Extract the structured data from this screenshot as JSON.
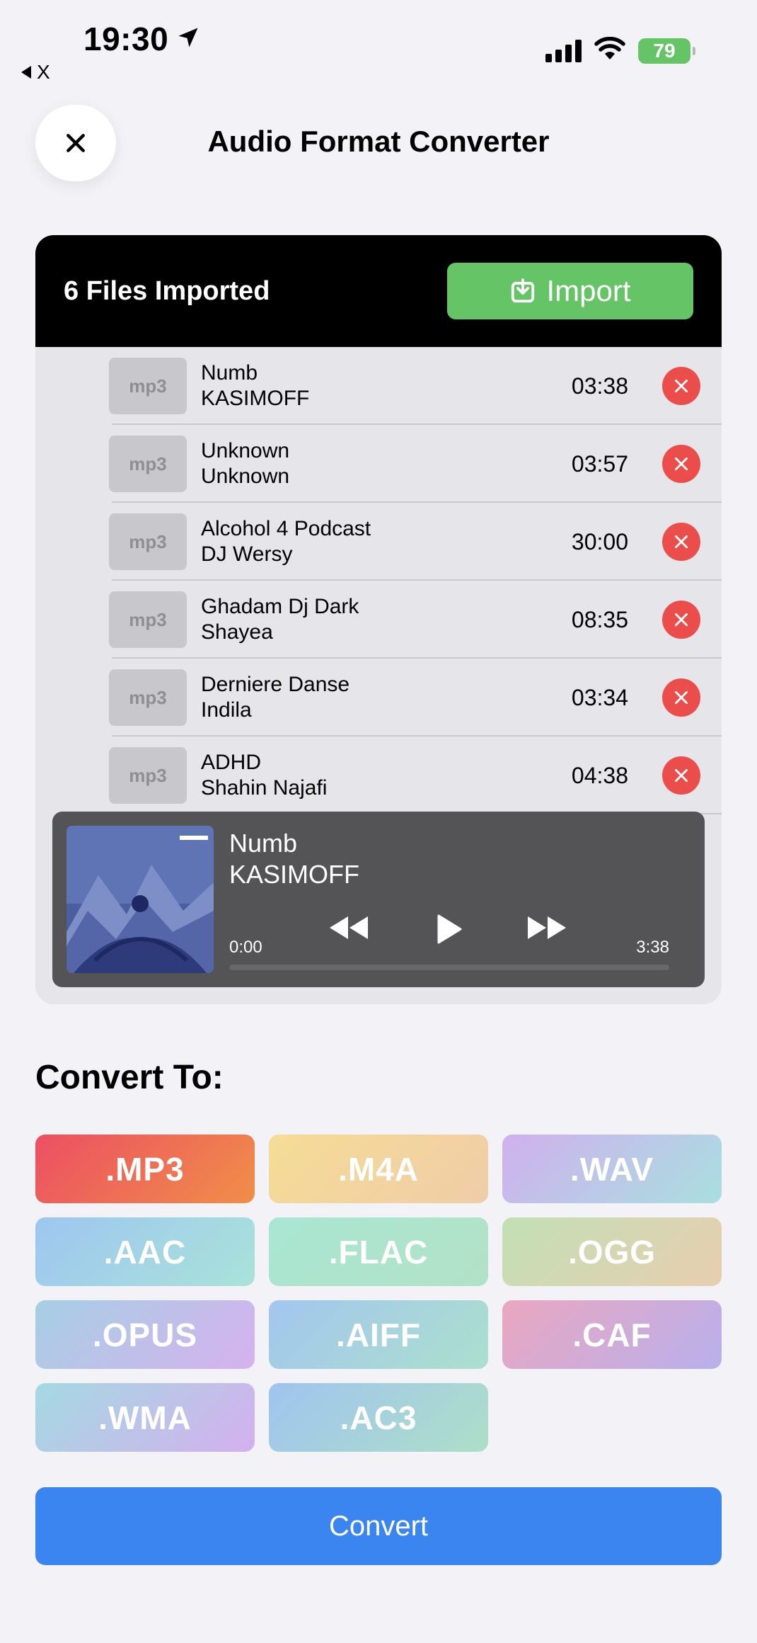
{
  "status": {
    "time": "19:30",
    "back_label": "X",
    "battery": "79"
  },
  "header": {
    "title": "Audio Format Converter"
  },
  "files": {
    "count_label": "6 Files Imported",
    "import_label": "Import",
    "items": [
      {
        "format": "mp3",
        "title": "Numb",
        "artist": "KASIMOFF",
        "duration": "03:38"
      },
      {
        "format": "mp3",
        "title": "Unknown",
        "artist": "Unknown",
        "duration": "03:57"
      },
      {
        "format": "mp3",
        "title": "Alcohol 4 Podcast",
        "artist": "DJ Wersy",
        "duration": "30:00"
      },
      {
        "format": "mp3",
        "title": "Ghadam Dj Dark",
        "artist": "Shayea",
        "duration": "08:35"
      },
      {
        "format": "mp3",
        "title": "Derniere Danse",
        "artist": "Indila",
        "duration": "03:34"
      },
      {
        "format": "mp3",
        "title": "ADHD",
        "artist": "Shahin Najafi",
        "duration": "04:38"
      }
    ]
  },
  "player": {
    "title": "Numb",
    "artist": "KASIMOFF",
    "elapsed": "0:00",
    "total": "3:38",
    "progress": 0
  },
  "convert": {
    "label": "Convert To:",
    "formats": [
      {
        "label": ".MP3",
        "gradient": "linear-gradient(135deg,#ec4f63,#f08f48)"
      },
      {
        "label": ".M4A",
        "gradient": "linear-gradient(135deg,#f5dd96,#f0cca8)"
      },
      {
        "label": ".WAV",
        "gradient": "linear-gradient(135deg,#d0b0ee,#a9dfe0)"
      },
      {
        "label": ".AAC",
        "gradient": "linear-gradient(135deg,#9ec6f0,#a9e3d9)"
      },
      {
        "label": ".FLAC",
        "gradient": "linear-gradient(135deg,#a9e6d3,#b2e2c6)"
      },
      {
        "label": ".OGG",
        "gradient": "linear-gradient(135deg,#c2e0b5,#e8ceb0)"
      },
      {
        "label": ".OPUS",
        "gradient": "linear-gradient(135deg,#a6cfe4,#d6b2ee)"
      },
      {
        "label": ".AIFF",
        "gradient": "linear-gradient(135deg,#a3c6ee,#ace0cd)"
      },
      {
        "label": ".CAF",
        "gradient": "linear-gradient(135deg,#eaa7c0,#b8b0ec)"
      },
      {
        "label": ".WMA",
        "gradient": "linear-gradient(135deg,#a4d9e2,#d4b0ee)"
      },
      {
        "label": ".AC3",
        "gradient": "linear-gradient(135deg,#a0c4ef,#addfc8)"
      }
    ],
    "button_label": "Convert"
  },
  "colors": {
    "accent_green": "#65c466",
    "accent_blue": "#3a85ef",
    "remove_red": "#eb4d4b"
  }
}
